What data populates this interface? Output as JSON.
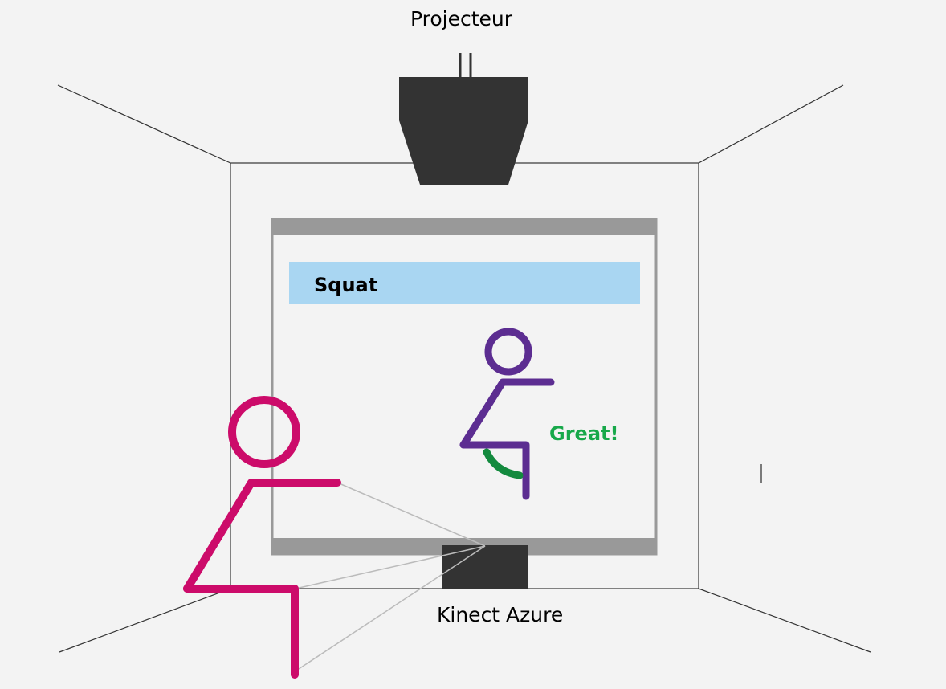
{
  "labels": {
    "projector": "Projecteur",
    "sensor": "Kinect Azure"
  },
  "screen": {
    "exercise_title": "Squat",
    "feedback": "Great!"
  },
  "colors": {
    "background": "#f3f3f3",
    "device": "#333333",
    "screen_frame_bar": "#999999",
    "title_bar": "#a9d6f2",
    "user_figure": "#cc0b6a",
    "avatar_figure": "#5c2d91",
    "feedback_arc": "#138a3e",
    "feedback_text": "#17a84a"
  },
  "icons": {
    "projector": "projector-icon",
    "sensor": "kinect-sensor-icon",
    "user": "user-stick-figure",
    "avatar": "avatar-stick-figure"
  }
}
